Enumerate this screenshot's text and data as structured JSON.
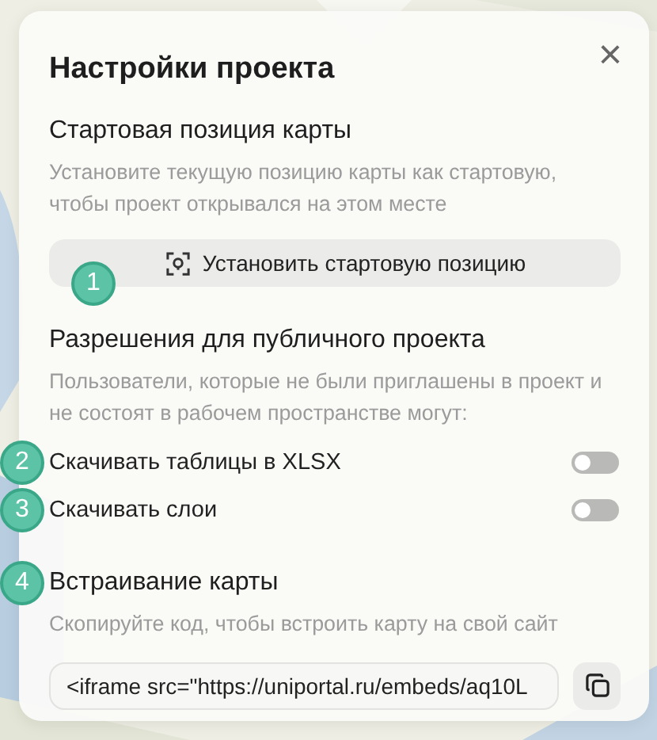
{
  "dialog": {
    "title": "Настройки проекта",
    "close": "×"
  },
  "start_position": {
    "heading": "Стартовая позиция карты",
    "description": "Установите текущую позицию карты как стартовую, чтобы проект открывался на этом месте",
    "button": {
      "label": "Установить стартовую позицию",
      "marker": "1"
    }
  },
  "permissions": {
    "heading": "Разрешения для публичного проекта",
    "description": "Пользователи, которые не были приглашены в проект и не состоят в рабочем пространстве могут:",
    "toggles": [
      {
        "label": "Скачивать таблицы в XLSX",
        "on": false,
        "marker": "2"
      },
      {
        "label": "Скачивать слои",
        "on": false,
        "marker": "3"
      }
    ]
  },
  "embed": {
    "heading": "Встраивание карты",
    "marker": "4",
    "description": "Скопируйте код, чтобы встроить карту на свой сайт",
    "code": "<iframe src=\"https://uniportal.ru/embeds/aq10L"
  }
}
